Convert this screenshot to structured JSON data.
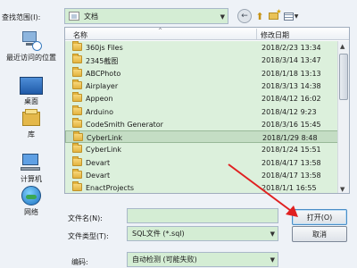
{
  "top": {
    "look_in_label": "查找范围(I):",
    "look_in_value": "文档",
    "back_glyph": "←",
    "up_glyph": "⬆"
  },
  "places": [
    {
      "label": "最近访问的位置",
      "icon": "recent-places-icon"
    },
    {
      "label": "桌面",
      "icon": "desktop-icon"
    },
    {
      "label": "库",
      "icon": "library-icon"
    },
    {
      "label": "计算机",
      "icon": "computer-icon"
    },
    {
      "label": "网络",
      "icon": "network-icon"
    }
  ],
  "list": {
    "name_header": "名称",
    "date_header": "修改日期",
    "rows": [
      {
        "name": "360js Files",
        "date": "2018/2/23 13:34"
      },
      {
        "name": "2345截图",
        "date": "2018/3/14 13:47"
      },
      {
        "name": "ABCPhoto",
        "date": "2018/1/18 13:13"
      },
      {
        "name": "Airplayer",
        "date": "2018/3/13 14:38"
      },
      {
        "name": "Appeon",
        "date": "2018/4/12 16:02"
      },
      {
        "name": "Arduino",
        "date": "2018/4/12 9:23"
      },
      {
        "name": "CodeSmith Generator",
        "date": "2018/3/16 15:45"
      },
      {
        "name": "CyberLink",
        "date": "2018/1/29 8:48"
      },
      {
        "name": "CyberLink",
        "date": "2018/1/24 15:51"
      },
      {
        "name": "Devart",
        "date": "2018/4/17 13:58"
      },
      {
        "name": "Devart",
        "date": "2018/4/17 13:58"
      },
      {
        "name": "EnactProjects",
        "date": "2018/1/1 16:55"
      }
    ],
    "selected_index": 7
  },
  "bottom": {
    "filename_label": "文件名(N):",
    "filename_value": "",
    "filetype_label": "文件类型(T):",
    "filetype_value": "SQL文件 (*.sql)",
    "encoding_label": "编码:",
    "encoding_value": "自动检测 (可能失败)",
    "open_label": "打开(O)",
    "cancel_label": "取消"
  },
  "colors": {
    "highlight": "#d4edd4",
    "annotation": "#e02020"
  }
}
